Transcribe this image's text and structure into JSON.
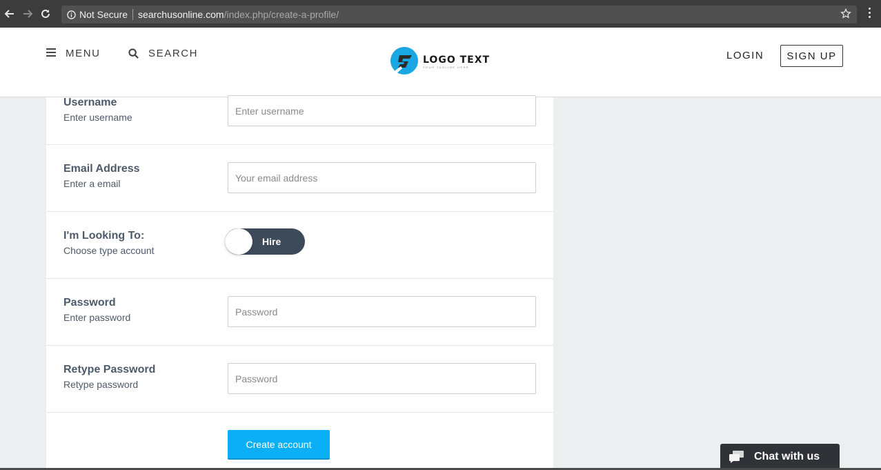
{
  "browser": {
    "security_label": "Not Secure",
    "url_host": "searchusonline.com",
    "url_path": "/index.php/create-a-profile/"
  },
  "header": {
    "menu_label": "MENU",
    "search_label": "SEARCH",
    "logo_title": "LOGO TEXT",
    "logo_tagline": "YOUR TAGLINE HERE",
    "login_label": "LOGIN",
    "signup_label": "SIGN UP"
  },
  "form": {
    "username": {
      "title": "Username",
      "subtitle": "Enter username",
      "placeholder": "Enter username"
    },
    "email": {
      "title": "Email Address",
      "subtitle": "Enter a email",
      "placeholder": "Your email address"
    },
    "looking": {
      "title": "I'm Looking To:",
      "subtitle": "Choose type account",
      "toggle_label": "Hire"
    },
    "password": {
      "title": "Password",
      "subtitle": "Enter password",
      "placeholder": "Password"
    },
    "retype": {
      "title": "Retype Password",
      "subtitle": "Retype password",
      "placeholder": "Password"
    },
    "submit_label": "Create account"
  },
  "chat": {
    "label": "Chat with us"
  },
  "colors": {
    "accent": "#0aaff5",
    "toggle": "#3d4a5a",
    "label": "#4d5a6a"
  }
}
